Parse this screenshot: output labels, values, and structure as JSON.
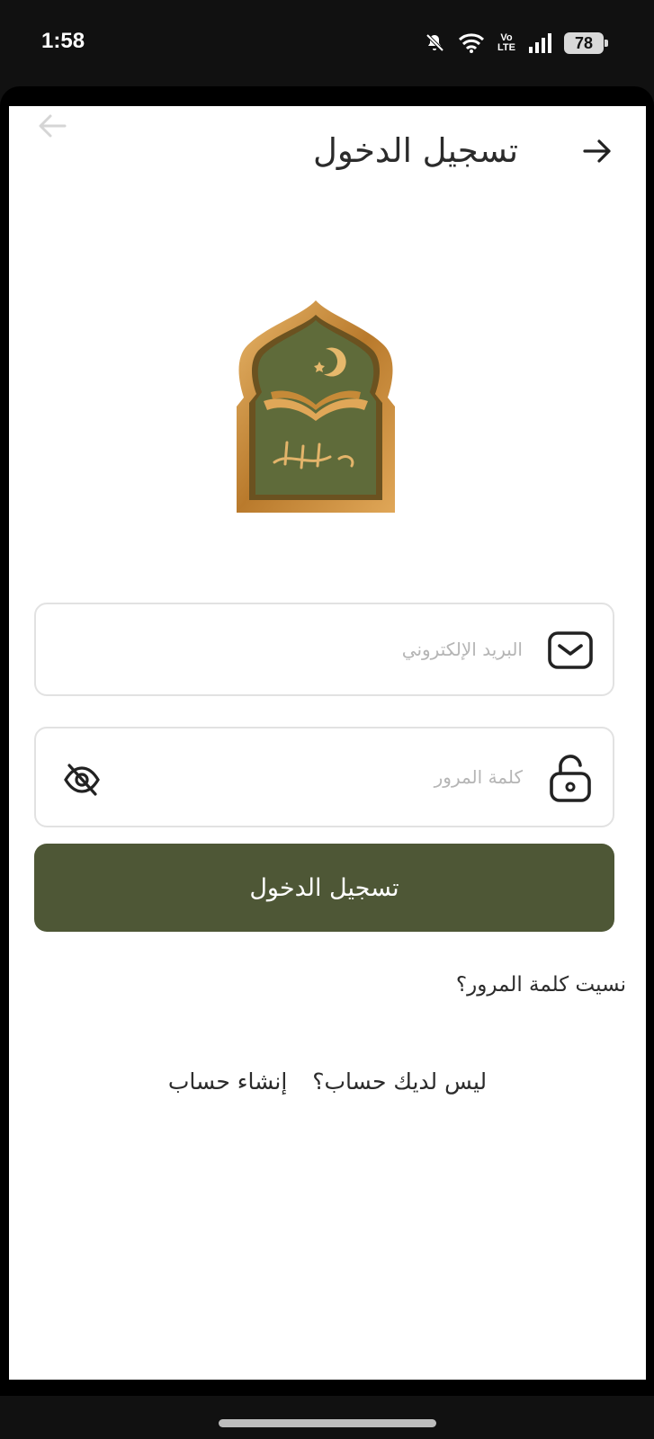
{
  "status_bar": {
    "time": "1:58",
    "battery": "78",
    "network_top": "Vo",
    "network_bottom": "LTE"
  },
  "header": {
    "title": "تسجيل الدخول",
    "back_icon": "arrow-right-icon"
  },
  "logo": {
    "alt": "الكتّاب",
    "colors": {
      "frame_gold": "#c9903c",
      "panel_green": "#5f6b3a"
    }
  },
  "form": {
    "email_placeholder": "البريد الإلكتروني",
    "email_value": "",
    "email_icon": "mail-icon",
    "password_placeholder": "كلمة المرور",
    "password_value": "",
    "password_icon": "unlock-icon",
    "toggle_icon": "eye-off-icon"
  },
  "actions": {
    "login_label": "تسجيل الدخول",
    "forgot_password": "نسيت كلمة المرور؟",
    "no_account": "ليس لديك حساب؟",
    "create_account": "إنشاء حساب"
  },
  "colors": {
    "primary": "#4e5736",
    "text": "#2b2b2b",
    "border": "#e2e2e2"
  }
}
